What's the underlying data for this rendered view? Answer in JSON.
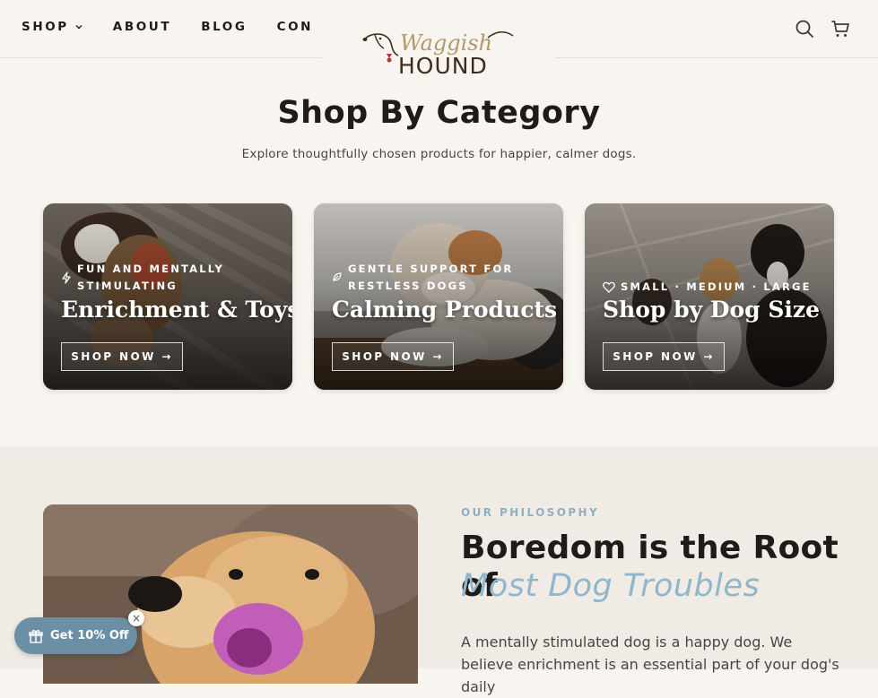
{
  "nav": {
    "items": [
      {
        "label": "SHOP",
        "has_dropdown": true
      },
      {
        "label": "ABOUT"
      },
      {
        "label": "BLOG"
      },
      {
        "label": "CONTACT"
      }
    ],
    "logo_text": "Waggish HOUND",
    "icons": [
      "search-icon",
      "cart-icon"
    ]
  },
  "categories": {
    "title": "Shop By Category",
    "subtitle": "Explore thoughtfully chosen products for happier, calmer dogs.",
    "cards": [
      {
        "tagline": "FUN AND MENTALLY STIMULATING",
        "tagline_line1": "FUN AND MENTALLY",
        "tagline_line2": "STIMULATING",
        "icon": "lightning-icon",
        "title": "Enrichment & Toys",
        "button": "SHOP NOW →"
      },
      {
        "tagline": "GENTLE SUPPORT FOR RESTLESS DOGS",
        "tagline_line1": "GENTLE SUPPORT FOR",
        "tagline_line2": "RESTLESS DOGS",
        "icon": "leaf-icon",
        "title": "Calming Products",
        "button": "SHOP NOW →"
      },
      {
        "tagline": "SMALL · MEDIUM · LARGE",
        "icon": "heart-icon",
        "title": "Shop by Dog Size",
        "button": "SHOP NOW →"
      }
    ]
  },
  "philosophy": {
    "eyebrow": "OUR PHILOSOPHY",
    "headline_line1": "Boredom is the Root of",
    "headline_line2": "Most Dog Troubles",
    "body": "A mentally stimulated dog is a happy dog. We believe enrichment is an essential part of your dog's daily"
  },
  "discount": {
    "label": "Get 10% Off",
    "close": "×"
  },
  "colors": {
    "background": "#f8f4ef",
    "accent": "#8fb6cb",
    "discount": "#6b8fa4",
    "text": "#1f1b17"
  }
}
